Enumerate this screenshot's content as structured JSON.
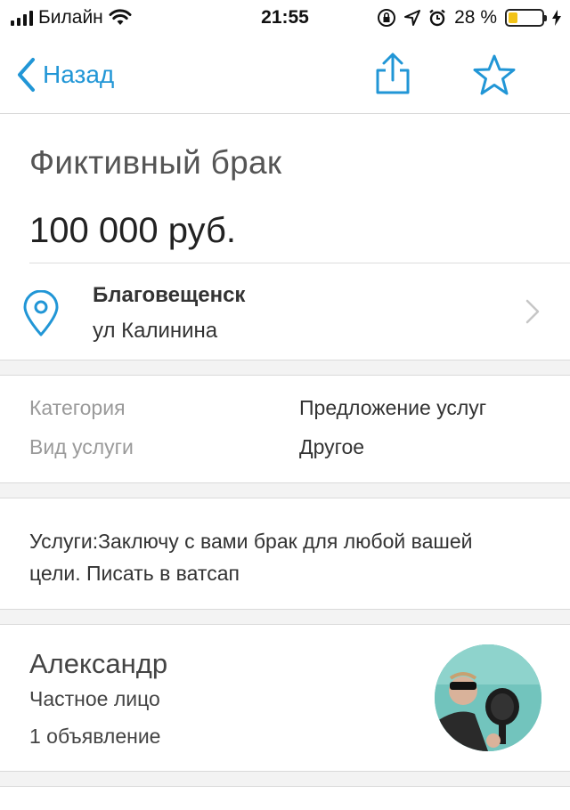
{
  "status_bar": {
    "carrier": "Билайн",
    "time": "21:55",
    "battery_percent": "28 %",
    "battery_level": 0.28
  },
  "nav": {
    "back_label": "Назад",
    "icons": [
      "chevron-left-icon",
      "share-icon",
      "star-icon"
    ],
    "accent_color": "#2196d6"
  },
  "listing": {
    "title": "Фиктивный брак",
    "price": "100 000 руб."
  },
  "address": {
    "city": "Благовещенск",
    "street": "ул Калинина"
  },
  "params": [
    {
      "label": "Категория",
      "value": "Предложение услуг"
    },
    {
      "label": "Вид услуги",
      "value": "Другое"
    }
  ],
  "description": "Услуги:Заключу с вами брак для любой вашей цели. Писать в ватсап",
  "seller": {
    "name": "Александр",
    "type": "Частное лицо",
    "ads_count": "1 объявление"
  }
}
